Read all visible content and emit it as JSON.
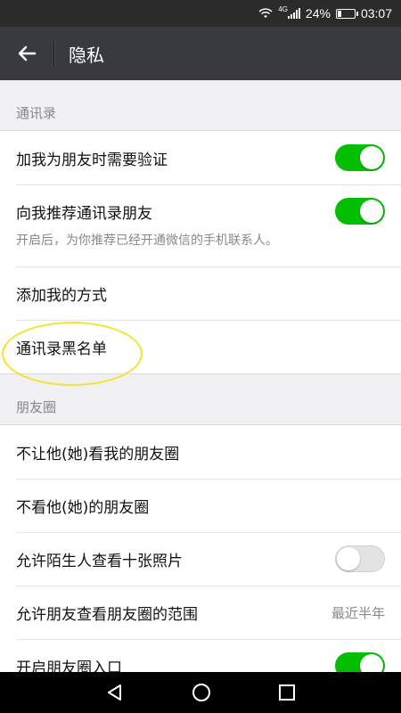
{
  "status_bar": {
    "network": "4G",
    "battery_percent": "24%",
    "battery_level": 0.24,
    "time": "03:07"
  },
  "nav": {
    "title": "隐私",
    "back_icon": "arrow-left-icon"
  },
  "sections": {
    "contacts": {
      "header": "通讯录",
      "require_verification": {
        "label": "加我为朋友时需要验证",
        "enabled": true
      },
      "recommend_contacts": {
        "label": "向我推荐通讯录朋友",
        "sub": "开启后，为你推荐已经开通微信的手机联系人。",
        "enabled": true
      },
      "add_methods": {
        "label": "添加我的方式"
      },
      "blacklist": {
        "label": "通讯录黑名单"
      }
    },
    "moments": {
      "header": "朋友圈",
      "hide_my_moments": {
        "label": "不让他(她)看我的朋友圈"
      },
      "hide_their_moments": {
        "label": "不看他(她)的朋友圈"
      },
      "allow_strangers": {
        "label": "允许陌生人查看十张照片",
        "enabled": false
      },
      "visible_range": {
        "label": "允许朋友查看朋友圈的范围",
        "value": "最近半年"
      },
      "moments_entry": {
        "label": "开启朋友圈入口",
        "enabled": true
      }
    }
  },
  "colors": {
    "toggle_on": "#04be02",
    "nav_bar": "#393a3f",
    "highlight": "#f3e42a"
  },
  "system_nav": {
    "back": "triangle-back-icon",
    "home": "circle-home-icon",
    "recents": "square-recents-icon"
  }
}
